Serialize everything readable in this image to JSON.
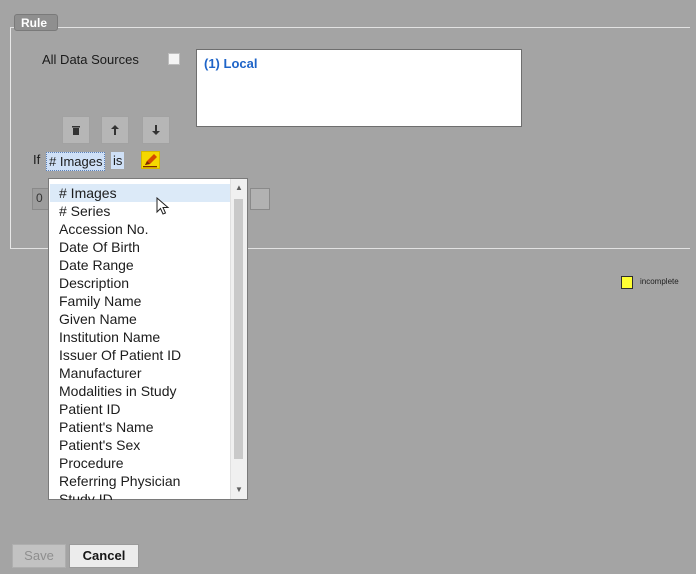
{
  "rule": {
    "legend": "Rule",
    "all_sources_label": "All Data Sources",
    "data_sources": [
      "(1)  Local"
    ],
    "toolbar": {
      "delete_icon": "trash-icon",
      "up_icon": "arrow-up-icon",
      "down_icon": "arrow-down-icon"
    },
    "condition": {
      "if_label": "If",
      "field": "# Images",
      "operator": "is",
      "edit_icon": "edit-pencil-icon"
    }
  },
  "dropdown": {
    "options": [
      "# Images",
      "# Series",
      "Accession No.",
      "Date Of Birth",
      "Date Range",
      "Description",
      "Family Name",
      "Given Name",
      "Institution Name",
      "Issuer Of Patient ID",
      "Manufacturer",
      "Modalities in Study",
      "Patient ID",
      "Patient's Name",
      "Patient's Sex",
      "Procedure",
      "Referring Physician",
      "Study ID"
    ],
    "selected": "# Images"
  },
  "legend_key": {
    "label": "incomplete",
    "color": "#ffff33"
  },
  "buttons": {
    "save": "Save",
    "cancel": "Cancel"
  }
}
